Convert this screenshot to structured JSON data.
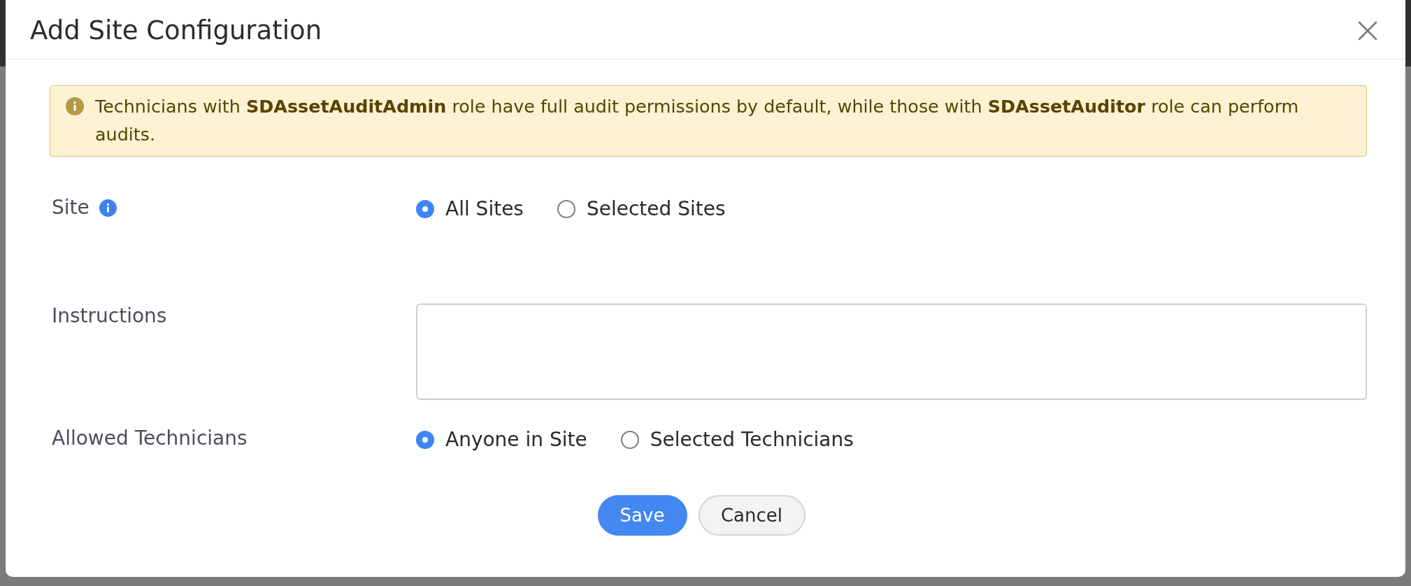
{
  "dialog": {
    "title": "Add Site Configuration"
  },
  "banner": {
    "text": "Technicians with **SDAssetAuditAdmin** role have full audit permissions by default, while those with **SDAssetAuditor** role can perform audits."
  },
  "fields": [
    {
      "kind": "radio",
      "label": "Site",
      "info": true,
      "options": [
        {
          "label": "All Sites",
          "selected": true
        },
        {
          "label": "Selected Sites",
          "selected": false
        }
      ]
    },
    {
      "kind": "textarea",
      "label": "Instructions"
    },
    {
      "kind": "radio",
      "label": "Allowed Technicians",
      "options": [
        {
          "label": "Anyone in Site",
          "selected": true
        },
        {
          "label": "Selected Technicians",
          "selected": false
        }
      ]
    }
  ],
  "buttons": [
    {
      "label": "Save",
      "kind": "primary"
    },
    {
      "label": "Cancel",
      "kind": "secondary"
    }
  ]
}
